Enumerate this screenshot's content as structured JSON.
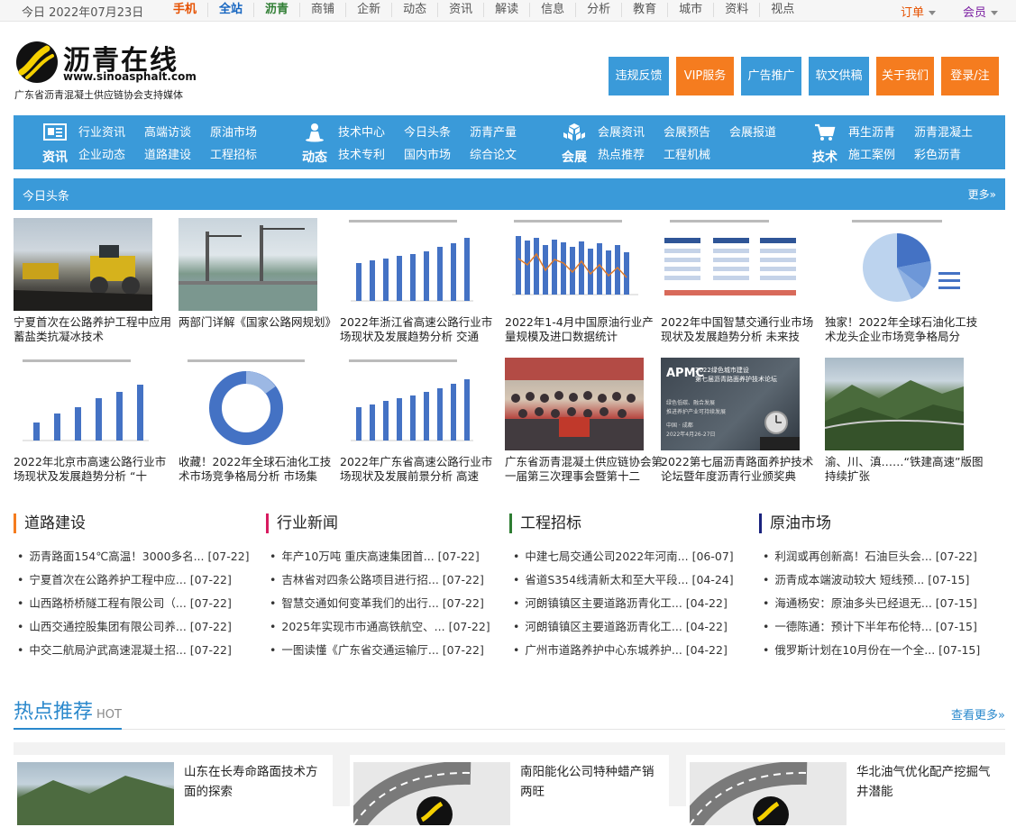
{
  "topbar": {
    "date": "今日 2022年07月23日",
    "links": [
      "手机",
      "全站",
      "沥青",
      "商铺",
      "企新",
      "动态",
      "资讯",
      "解读",
      "信息",
      "分析",
      "教育",
      "城市",
      "资料",
      "视点"
    ],
    "order": "订单",
    "member": "会员"
  },
  "logo": {
    "name": "沥青在线",
    "url": "www.sinoasphalt.com",
    "tagline": "广东省沥青混凝土供应链协会支持媒体"
  },
  "header_buttons": [
    "违规反馈",
    "VIP服务",
    "广告推广",
    "软文供稿",
    "关于我们",
    "登录/注册"
  ],
  "nav": [
    {
      "head": "资讯",
      "icon": "news-icon",
      "items": [
        "行业资讯",
        "高端访谈",
        "原油市场",
        "企业动态",
        "道路建设",
        "工程招标"
      ]
    },
    {
      "head": "动态",
      "icon": "person-icon",
      "items": [
        "技术中心",
        "今日头条",
        "沥青产量",
        "技术专利",
        "国内市场",
        "综合论文"
      ]
    },
    {
      "head": "会展",
      "icon": "cubes-icon",
      "items": [
        "会展资讯",
        "会展预告",
        "会展报道",
        "热点推荐",
        "工程机械",
        ""
      ]
    },
    {
      "head": "技术",
      "icon": "cart-icon",
      "items": [
        "再生沥青",
        "沥青混凝土",
        "施工案例",
        "彩色沥青"
      ]
    }
  ],
  "headline_bar": {
    "title": "今日头条",
    "more": "更多»"
  },
  "thumbs": [
    {
      "caption": "宁夏首次在公路养护工程中应用蓄盐类抗凝冰技术"
    },
    {
      "caption": "两部门详解《国家公路网规划》"
    },
    {
      "caption": "2022年浙江省高速公路行业市场现状及发展趋势分析 交通"
    },
    {
      "caption": "2022年1-4月中国原油行业产量规模及进口数据统计"
    },
    {
      "caption": "2022年中国智慧交通行业市场现状及发展趋势分析 未来技"
    },
    {
      "caption": "独家！2022年全球石油化工技术龙头企业市场竞争格局分"
    },
    {
      "caption": "2022年北京市高速公路行业市场现状及发展趋势分析 “十"
    },
    {
      "caption": "收藏！2022年全球石油化工技术市场竞争格局分析 市场集"
    },
    {
      "caption": "2022年广东省高速公路行业市场现状及发展前景分析 高速"
    },
    {
      "caption": "广东省沥青混凝土供应链协会第一届第三次理事会暨第十二"
    },
    {
      "caption": "2022第七届沥青路面养护技术论坛暨年度沥青行业颁奖典"
    },
    {
      "caption": "渝、川、滇……“铁建高速”版图持续扩张"
    }
  ],
  "apmc_text": {
    "logo": "APMC",
    "l1": "2022绿色城市建设",
    "l2": "第七届沥青路面养护技术论坛",
    "l3": "绿色低碳、融合发展",
    "l4": "推进养护产业可持续发展",
    "l5": "中国 · 成都",
    "l6": "2022年4月26-27日"
  },
  "columns": [
    {
      "title": "道路建设",
      "color": "#f57c1f",
      "items": [
        "沥青路面154℃高温！3000多名... [07-22]",
        "宁夏首次在公路养护工程中应... [07-22]",
        "山西路桥桥隧工程有限公司（... [07-22]",
        "山西交通控股集团有限公司养... [07-22]",
        "中交二航局沪武高速混凝土招... [07-22]"
      ]
    },
    {
      "title": "行业新闻",
      "color": "#d81b60",
      "items": [
        "年产10万吨 重庆高速集团首... [07-22]",
        "吉林省对四条公路项目进行招... [07-22]",
        "智慧交通如何变革我们的出行... [07-22]",
        "2025年实现市市通高铁航空、... [07-22]",
        "一图读懂《广东省交通运输厅... [07-22]"
      ]
    },
    {
      "title": "工程招标",
      "color": "#2e7d32",
      "items": [
        "中建七局交通公司2022年河南... [06-07]",
        "省道S354线清新太和至大平段... [04-24]",
        "河朗镇镇区主要道路沥青化工... [04-22]",
        "河朗镇镇区主要道路沥青化工... [04-22]",
        "广州市道路养护中心东城养护... [04-22]"
      ]
    },
    {
      "title": "原油市场",
      "color": "#1a237e",
      "items": [
        "利润或再创新高！石油巨头会... [07-22]",
        "沥青成本端波动较大 短线预... [07-15]",
        "海通杨安：原油多头已经退无... [07-15]",
        "一德陈通：预计下半年布伦特... [07-15]",
        "俄罗斯计划在10月份在一个全... [07-15]"
      ]
    }
  ],
  "hot": {
    "title": "热点推荐",
    "sub": "HOT",
    "more": "查看更多»"
  },
  "hot_cards": [
    {
      "title": "山东在长寿命路面技术方面的探索"
    },
    {
      "title": "南阳能化公司特种蜡产销两旺"
    },
    {
      "title": "华北油气优化配产挖掘气井潜能"
    }
  ]
}
